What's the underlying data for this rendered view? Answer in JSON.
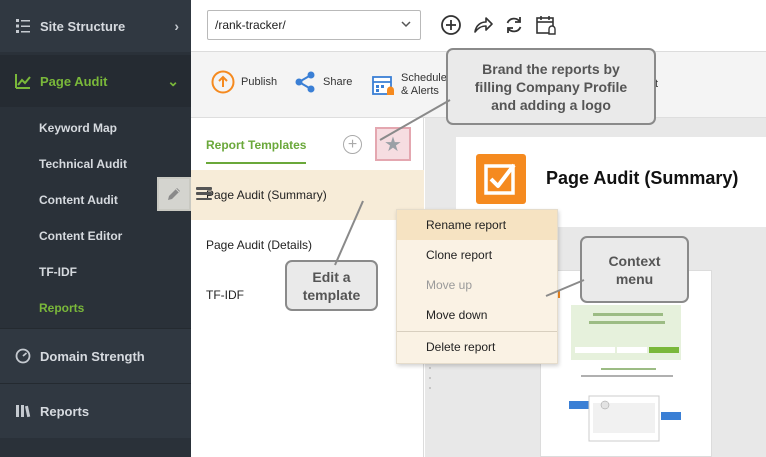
{
  "sidebar": {
    "site_structure": "Site Structure",
    "page_audit": "Page Audit",
    "sub_items": [
      "Keyword Map",
      "Technical Audit",
      "Content Audit",
      "Content Editor",
      "TF-IDF",
      "Reports"
    ],
    "active_sub_item": "Reports",
    "domain_strength": "Domain Strength",
    "reports": "Reports"
  },
  "topbar": {
    "url_value": "/rank-tracker/",
    "icons": [
      "add-project-icon",
      "share-arrow-icon",
      "refresh-icon",
      "scheduled-calendar-icon"
    ]
  },
  "toolbar": {
    "publish": "Publish",
    "share": "Share",
    "schedule_line1": "Schedule",
    "schedule_line2": "& Alerts",
    "partial_label": "t"
  },
  "panel": {
    "tab_label": "Report Templates",
    "templates": [
      "Page Audit (Summary)",
      "Page Audit (Details)",
      "TF-IDF"
    ],
    "selected_template": "Page Audit (Summary)"
  },
  "preview": {
    "title": "Page Audit (Summary)"
  },
  "context_menu": {
    "items": [
      "Rename report",
      "Clone report",
      "Move up",
      "Move down",
      "Delete report"
    ],
    "disabled": [
      "Move up"
    ],
    "highlighted": "Rename report"
  },
  "callouts": {
    "brand_line1": "Brand the reports by",
    "brand_line2": "filling Company Profile",
    "brand_line3": "and adding a logo",
    "edit_line1": "Edit a",
    "edit_line2": "template",
    "ctx_line1": "Context",
    "ctx_line2": "menu"
  },
  "colors": {
    "accent_green": "#7ab83a",
    "sidebar_bg": "#2a3139",
    "orange": "#f58a1f",
    "share_blue": "#3a7fd5"
  }
}
